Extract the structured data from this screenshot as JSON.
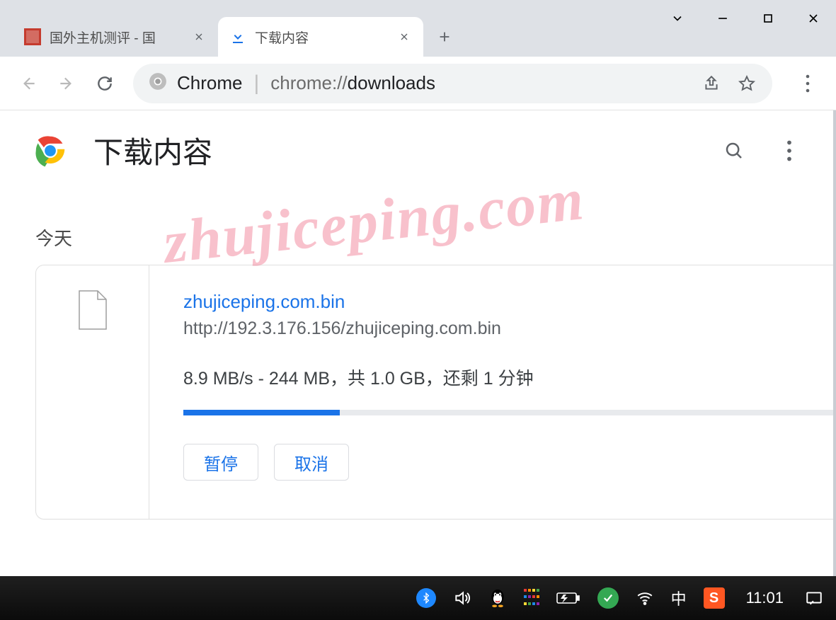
{
  "tabs": [
    {
      "title": "国外主机测评 - 国",
      "active": false
    },
    {
      "title": "下载内容",
      "active": true
    }
  ],
  "omnibox": {
    "prefix": "Chrome",
    "url_plain_a": "chrome://",
    "url_bold": "downloads",
    "url_plain_b": ""
  },
  "page": {
    "title": "下载内容",
    "section": "今天"
  },
  "download": {
    "filename": "zhujiceping.com.bin",
    "url": "http://192.3.176.156/zhujiceping.com.bin",
    "status": "8.9 MB/s - 244 MB，共 1.0 GB，还剩 1 分钟",
    "progress_percent": 24,
    "pause_label": "暂停",
    "cancel_label": "取消"
  },
  "watermark": "zhujiceping.com",
  "taskbar": {
    "ime": "中",
    "sogou": "S",
    "clock": "11:01"
  }
}
